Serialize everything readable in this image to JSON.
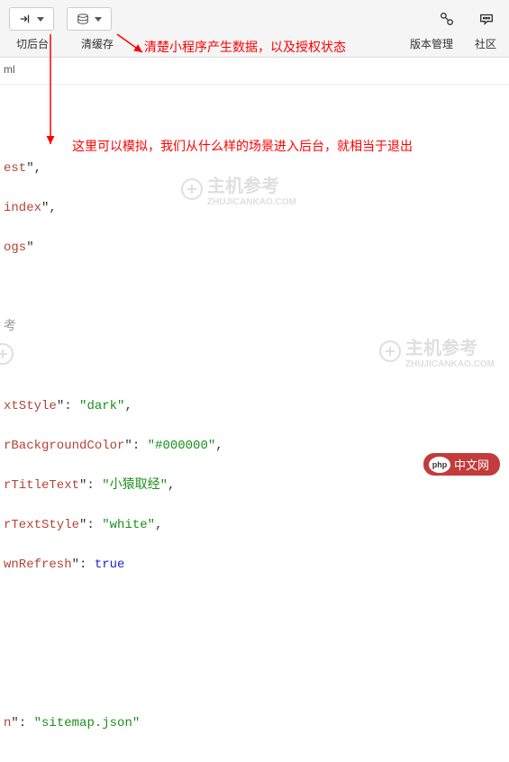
{
  "toolbar": {
    "switch_bg_label": "切后台",
    "clear_cache_label": "清缓存",
    "version_mgmt_label": "版本管理",
    "community_label": "社区"
  },
  "tabs": {
    "file_suffix": "ml"
  },
  "annotations": {
    "a1": "清楚小程序产生数据，以及授权状态",
    "a2": "这里可以模拟，我们从什么样的场景进入后台，就相当于退出"
  },
  "code": {
    "l1_key": "est",
    "l2_key": "index",
    "l3_key": "ogs",
    "l4_comment": "考",
    "l5_key": "xtStyle",
    "l5_val": "dark",
    "l6_key": "rBackgroundColor",
    "l6_val": "#000000",
    "l7_key": "rTitleText",
    "l7_val": "小猿取经",
    "l8_key": "rTextStyle",
    "l8_val": "white",
    "l9_key": "wnRefresh",
    "l9_val": "true",
    "l10_key": "n",
    "l10_val": "sitemap.json"
  },
  "watermark": {
    "brand": "主机参考",
    "sub": "ZHUJICANKAO.COM"
  },
  "footer": {
    "php_label": "php",
    "php_text": "中文网"
  }
}
